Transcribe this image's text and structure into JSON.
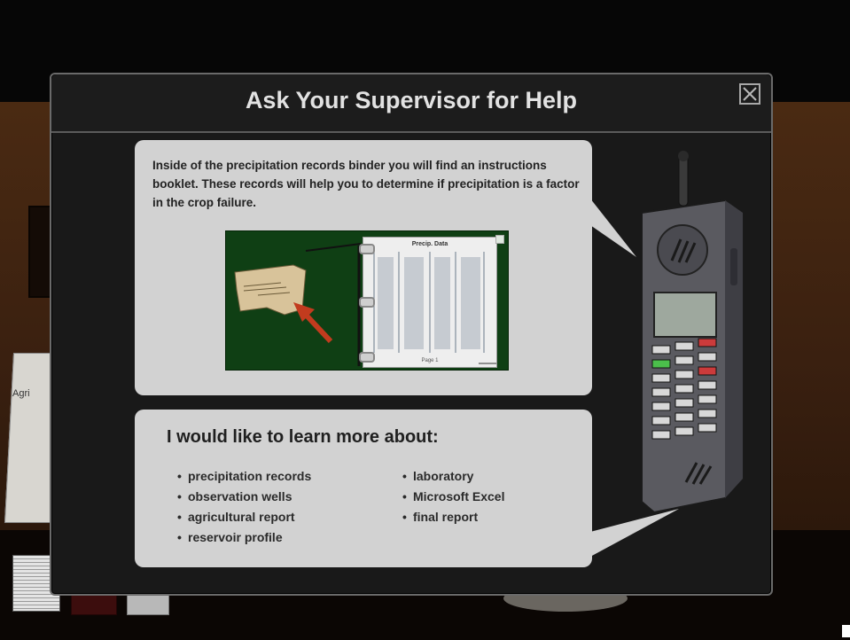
{
  "dialog": {
    "title": "Ask Your Supervisor for Help",
    "instructions": "Inside of the precipitation records binder you will find an instructions booklet.  These records will help you to determine if precipitation is a factor in the crop failure."
  },
  "binder_image": {
    "sheet_title": "Precip. Data",
    "sheet_footer": "Page 1"
  },
  "learn_more": {
    "heading": "I would like to learn more about:",
    "bullet": "•",
    "left_column": [
      "precipitation records",
      "observation wells",
      "agricultural report",
      "reservoir profile"
    ],
    "right_column": [
      "laboratory",
      "Microsoft Excel",
      "final report"
    ]
  },
  "background": {
    "paper_label": "Agri"
  },
  "colors": {
    "modal_bg": "#191919",
    "bubble_bg": "#d2d2d2",
    "binder_green": "#0f3f14",
    "arrow_red": "#c23b1e"
  },
  "icons": [
    "close-icon",
    "phone-icon",
    "arrow-icon"
  ]
}
